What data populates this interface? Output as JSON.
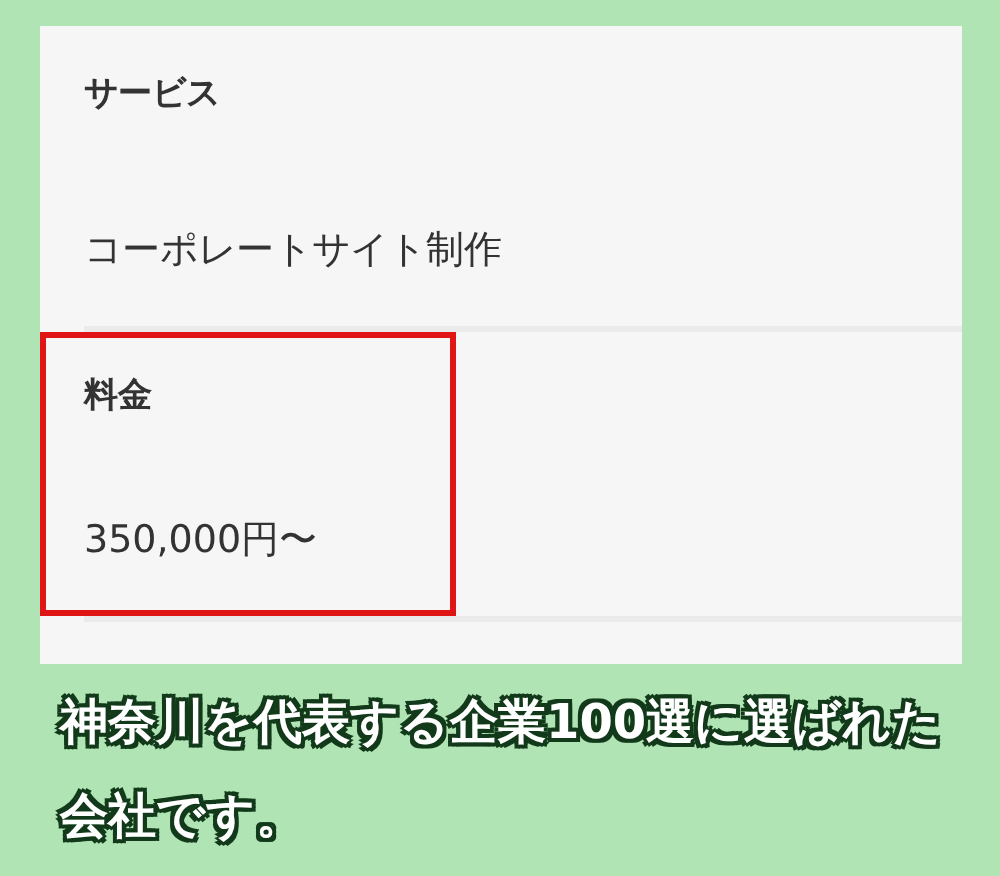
{
  "fields": [
    {
      "label": "サービス",
      "value": "コーポレートサイト制作",
      "highlighted": false
    },
    {
      "label": "料金",
      "value": "350,000円〜",
      "highlighted": true
    }
  ],
  "caption": "神奈川を代表する企業100選に選ばれた会社です。"
}
